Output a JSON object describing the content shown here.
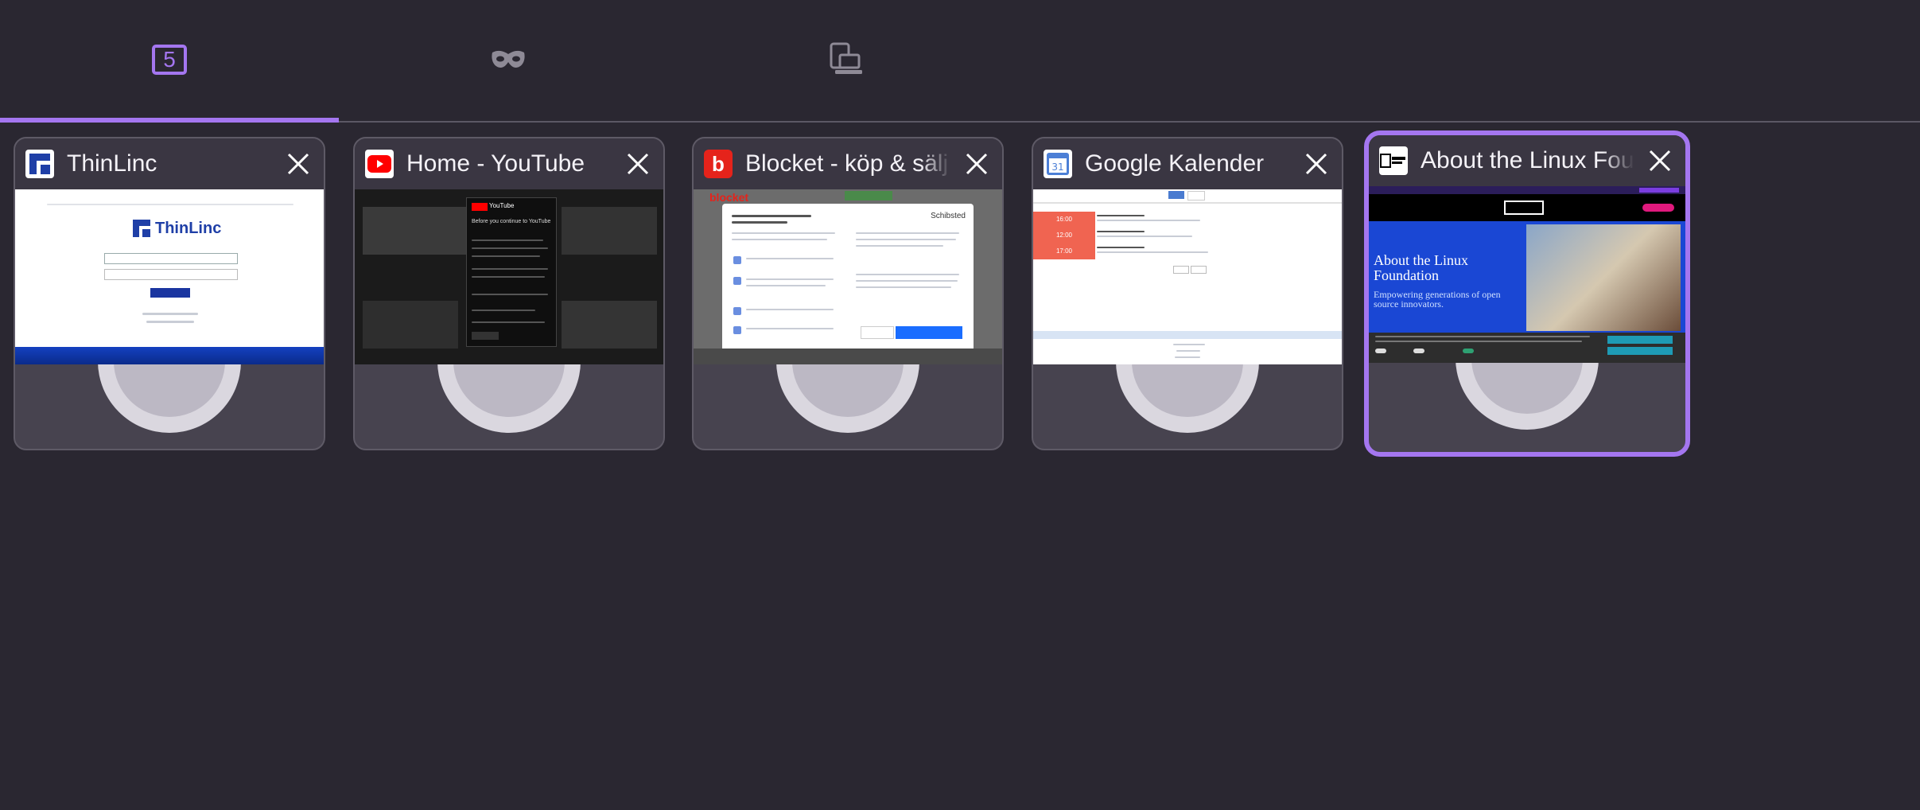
{
  "top_tabs": {
    "open_tab_count": "5",
    "private_icon": "mask-icon",
    "synced_icon": "synced-devices-icon"
  },
  "colors": {
    "accent": "#a476f0",
    "background": "#2a2731",
    "card": "#47434f"
  },
  "tabs": [
    {
      "title": "ThinLinc",
      "favicon": "thinlinc-logo-icon",
      "thumb_text": {
        "brand": "ThinLinc"
      }
    },
    {
      "title": "Home - YouTube",
      "favicon": "youtube-logo-icon",
      "thumb_text": {
        "brand": "YouTube",
        "dialog": "Before you continue to YouTube"
      }
    },
    {
      "title": "Blocket - köp & sälj (",
      "favicon": "blocket-logo-icon",
      "thumb_text": {
        "brand": "blocket",
        "dialog_brand": "Schibsted"
      }
    },
    {
      "title": "Google Kalender",
      "favicon": "google-calendar-icon",
      "thumb_text": {
        "time1": "16:00",
        "time2": "12:00",
        "time3": "17:00"
      }
    },
    {
      "title": "About the Linux Fou",
      "favicon": "linux-foundation-logo-icon",
      "selected": true,
      "thumb_text": {
        "heading": "About the Linux Foundation",
        "sub": "Empowering generations of open source innovators."
      }
    }
  ]
}
